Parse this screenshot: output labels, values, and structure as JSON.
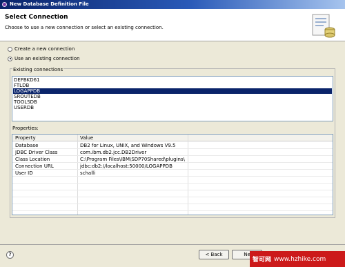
{
  "window": {
    "title": "New Database Definition File"
  },
  "header": {
    "title": "Select Connection",
    "description": "Choose to use a new connection or select an existing connection."
  },
  "options": {
    "create_new": "Create a new connection",
    "use_existing": "Use an existing connection",
    "selected": "use_existing"
  },
  "connections": {
    "label": "Existing connections",
    "items": [
      "DEFBKD61",
      "FTLDB",
      "LOGAPPDB",
      "SROUTEDB",
      "TOOLSDB",
      "USERDB"
    ],
    "selected": "LOGAPPDB"
  },
  "properties": {
    "label": "Properties:",
    "columns": [
      "Property",
      "Value"
    ],
    "rows": [
      [
        "Database",
        "DB2 for Linux, UNIX, and Windows V9.5"
      ],
      [
        "JDBC Driver Class",
        "com.ibm.db2.jcc.DB2Driver"
      ],
      [
        "Class Location",
        "C:\\Program Files\\IBM\\SDP70Shared\\plugins\\co..."
      ],
      [
        "Connection URL",
        "jdbc:db2://localhost:50000/LOGAPPDB"
      ],
      [
        "User ID",
        "schalli"
      ]
    ]
  },
  "buttons": {
    "back": "< Back",
    "next": "Ne"
  },
  "watermark": {
    "cn": "智可网",
    "url": "www.hzhike.com"
  },
  "colors": {
    "selection": "#0a246a",
    "watermark": "#cc1a1a",
    "titlebar": "#0a246a"
  },
  "icons": [
    "app-icon",
    "wizard-icon",
    "help-icon"
  ]
}
